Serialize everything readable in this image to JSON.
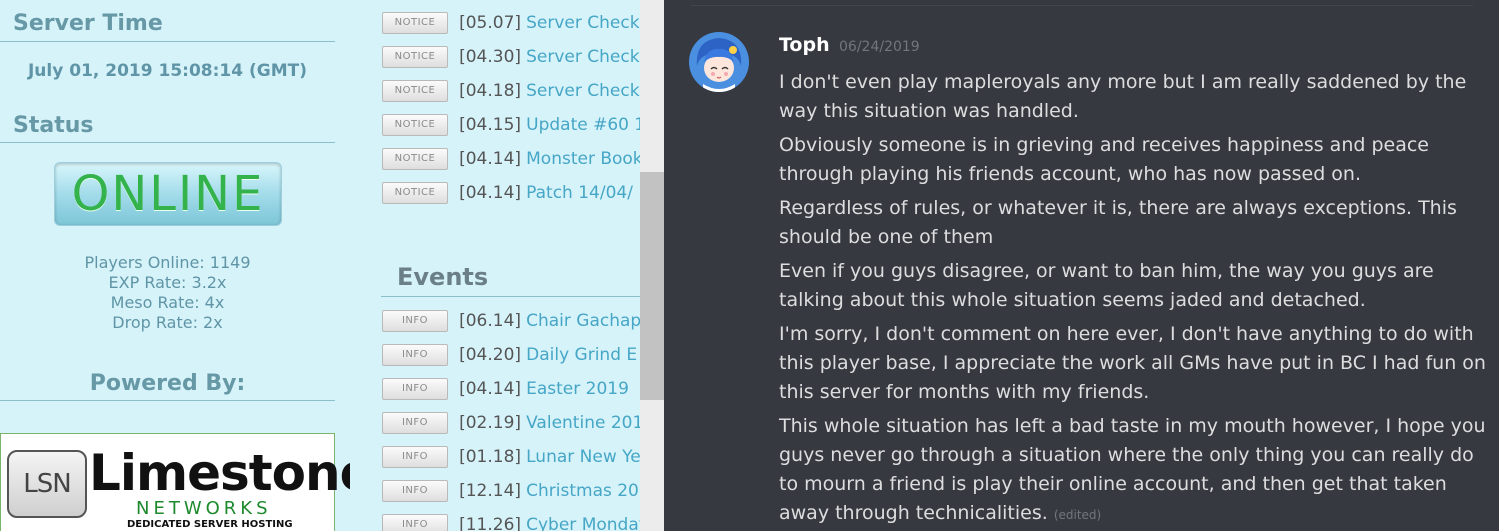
{
  "sidebar": {
    "server_time_heading": "Server Time",
    "server_time_value": "July 01, 2019 15:08:14 (GMT)",
    "status_heading": "Status",
    "status_badge": "ONLINE",
    "rates": {
      "players_online": "Players Online: 1149",
      "exp_rate": "EXP Rate: 3.2x",
      "meso_rate": "Meso Rate: 4x",
      "drop_rate": "Drop Rate: 2x"
    },
    "powered_by": "Powered By:",
    "sponsor": {
      "logo_mark": "LSN",
      "name": "Limestone",
      "sub": "NETWORKS",
      "tagline": "DEDICATED SERVER HOSTING"
    }
  },
  "news": [
    {
      "tag": "NOTICE",
      "date": "[05.07]",
      "title": "Server Check"
    },
    {
      "tag": "NOTICE",
      "date": "[04.30]",
      "title": "Server Check"
    },
    {
      "tag": "NOTICE",
      "date": "[04.18]",
      "title": "Server Check"
    },
    {
      "tag": "NOTICE",
      "date": "[04.15]",
      "title": "Update #60 1"
    },
    {
      "tag": "NOTICE",
      "date": "[04.14]",
      "title": "Monster Book"
    },
    {
      "tag": "NOTICE",
      "date": "[04.14]",
      "title": "Patch 14/04/"
    }
  ],
  "events_heading": "Events",
  "events": [
    {
      "tag": "INFO",
      "date": "[06.14]",
      "title": "Chair Gachap"
    },
    {
      "tag": "INFO",
      "date": "[04.20]",
      "title": "Daily Grind E"
    },
    {
      "tag": "INFO",
      "date": "[04.14]",
      "title": "Easter 2019"
    },
    {
      "tag": "INFO",
      "date": "[02.19]",
      "title": "Valentine 201"
    },
    {
      "tag": "INFO",
      "date": "[01.18]",
      "title": "Lunar New Ye"
    },
    {
      "tag": "INFO",
      "date": "[12.14]",
      "title": "Christmas 20"
    },
    {
      "tag": "INFO",
      "date": "[11.26]",
      "title": "Cyber Monday"
    }
  ],
  "chat": {
    "author": "Toph",
    "timestamp": "06/24/2019",
    "messages": [
      "I don't even play mapleroyals any more but I am really saddened by the way this situation was handled.",
      "Obviously someone is in grieving and receives happiness and peace through playing his friends account, who has now passed on.",
      "Regardless of rules, or whatever it is, there are always exceptions. This should be one of them",
      "Even if you guys disagree, or want to ban him, the way you guys are talking about this whole situation seems jaded and detached.",
      "I'm sorry, I don't comment on here ever, I don't have anything to do with this player base, I appreciate the work all GMs have put in BC I had fun on this server for months with my friends.",
      "This whole situation has left a bad taste in my mouth however, I hope you guys never go through a situation where the only thing you can really do to mourn a friend is play their online account, and then get that taken away through technicalities."
    ],
    "edited_label": "(edited)"
  },
  "colors": {
    "sidebar_bg": "#d6f3fa",
    "link": "#46a6c6",
    "online_green": "#34b24b",
    "chat_bg": "#36393f"
  }
}
